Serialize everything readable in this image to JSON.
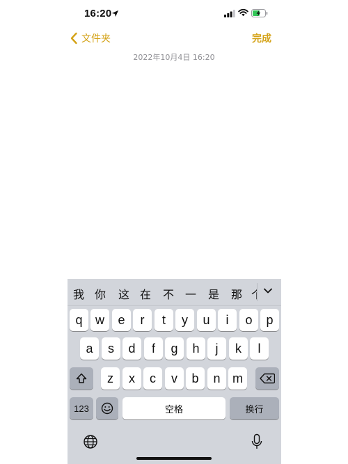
{
  "status_bar": {
    "time": "16:20",
    "location_icon": "location-arrow-icon",
    "signal_icon": "cellular-signal-icon",
    "wifi_icon": "wifi-icon",
    "battery_icon": "battery-charging-icon",
    "battery_color": "#34c759"
  },
  "navbar": {
    "back_label": "文件夹",
    "done_label": "完成",
    "accent_color": "#d4a216"
  },
  "note": {
    "date": "2022年10月4日 16:20",
    "body": ""
  },
  "keyboard": {
    "candidates": [
      "我",
      "你",
      "这",
      "在",
      "不",
      "一",
      "是",
      "那",
      "个"
    ],
    "row1": [
      "q",
      "w",
      "e",
      "r",
      "t",
      "y",
      "u",
      "i",
      "o",
      "p"
    ],
    "row2": [
      "a",
      "s",
      "d",
      "f",
      "g",
      "h",
      "j",
      "k",
      "l"
    ],
    "row3": [
      "z",
      "x",
      "c",
      "v",
      "b",
      "n",
      "m"
    ],
    "numbers_label": "123",
    "space_label": "空格",
    "return_label": "换行"
  }
}
